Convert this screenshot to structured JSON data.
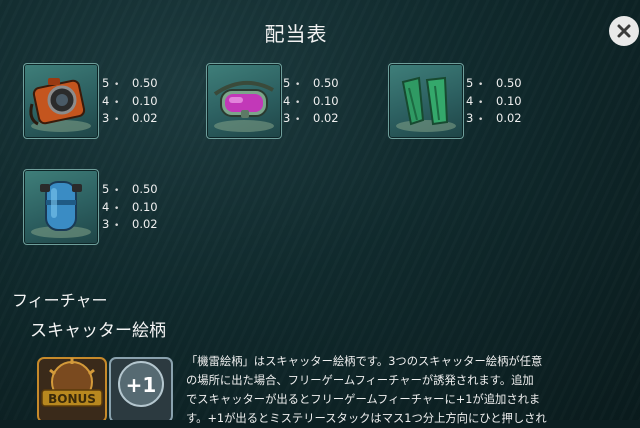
{
  "header": {
    "title": "配当表"
  },
  "paytable": [
    {
      "symbol": "camera-icon",
      "pays": [
        {
          "count": "5",
          "value": "0.50"
        },
        {
          "count": "4",
          "value": "0.10"
        },
        {
          "count": "3",
          "value": "0.02"
        }
      ]
    },
    {
      "symbol": "diving-mask-icon",
      "pays": [
        {
          "count": "5",
          "value": "0.50"
        },
        {
          "count": "4",
          "value": "0.10"
        },
        {
          "count": "3",
          "value": "0.02"
        }
      ]
    },
    {
      "symbol": "fins-icon",
      "pays": [
        {
          "count": "5",
          "value": "0.50"
        },
        {
          "count": "4",
          "value": "0.10"
        },
        {
          "count": "3",
          "value": "0.02"
        }
      ]
    },
    {
      "symbol": "oxygen-tank-icon",
      "pays": [
        {
          "count": "5",
          "value": "0.50"
        },
        {
          "count": "4",
          "value": "0.10"
        },
        {
          "count": "3",
          "value": "0.02"
        }
      ]
    }
  ],
  "features": {
    "heading": "フィーチャー",
    "scatter": {
      "heading": "スキャッター絵柄",
      "bonus_label": "BONUS",
      "plus_label": "+1",
      "lines": [
        "「機雷絵柄」はスキャッター絵柄です。3つのスキャッター絵柄が任意",
        "の場所に出た場合、フリーゲームフィーチャーが誘発されます。追加",
        "でスキャッターが出るとフリーゲームフィーチャーに+1が追加されま",
        "す。+1が出るとミステリースタックはマス1つ分上方向にひと押しされ"
      ]
    }
  },
  "colors": {
    "background": "#0d1f22",
    "tile": "#2c5f60",
    "text": "#f0f0f0"
  }
}
